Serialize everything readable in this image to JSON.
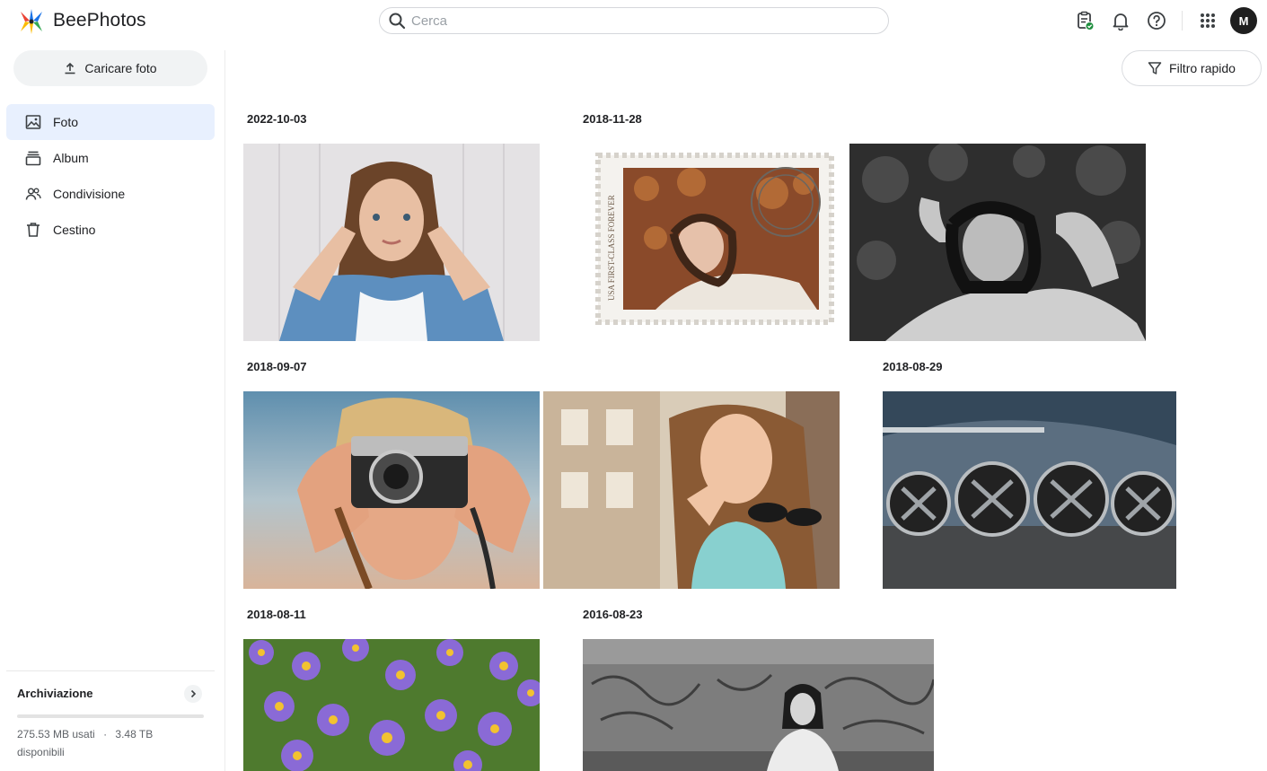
{
  "app": {
    "name": "BeePhotos"
  },
  "search": {
    "placeholder": "Cerca"
  },
  "header": {
    "icons": [
      "clipboard-check-icon",
      "bell-icon",
      "help-icon",
      "apps-grid-icon"
    ],
    "avatar_initial": "M"
  },
  "sidebar": {
    "upload_label": "Caricare foto",
    "items": [
      {
        "label": "Foto",
        "icon": "image-icon",
        "active": true
      },
      {
        "label": "Album",
        "icon": "album-icon",
        "active": false
      },
      {
        "label": "Condivisione",
        "icon": "people-icon",
        "active": false
      },
      {
        "label": "Cestino",
        "icon": "trash-icon",
        "active": false
      }
    ],
    "storage": {
      "title": "Archiviazione",
      "used": "275.53 MB usati",
      "separator": "·",
      "available": "3.48 TB",
      "available_suffix": "disponibili",
      "used_fraction": 0.0001
    }
  },
  "toolbar": {
    "filter_label": "Filtro rapido"
  },
  "groups": [
    {
      "date": "2022-10-03",
      "photos": [
        "woman-peace-sign"
      ]
    },
    {
      "date": "2018-11-28",
      "photos": [
        "postage-stamp-woman",
        "woman-leaves-bw"
      ]
    },
    {
      "date": "2018-09-07",
      "photos": [
        "woman-camera",
        "woman-sunglasses"
      ]
    },
    {
      "date": "2018-08-29",
      "photos": [
        "industrial-fans"
      ]
    },
    {
      "date": "2018-08-11",
      "photos": [
        "purple-flowers"
      ]
    },
    {
      "date": "2016-08-23",
      "photos": [
        "woman-graffiti-bw"
      ]
    }
  ],
  "colors": {
    "accent": "#1a73e8",
    "active_nav": "#e8f0fe",
    "badge_green": "#1e8e3e"
  }
}
